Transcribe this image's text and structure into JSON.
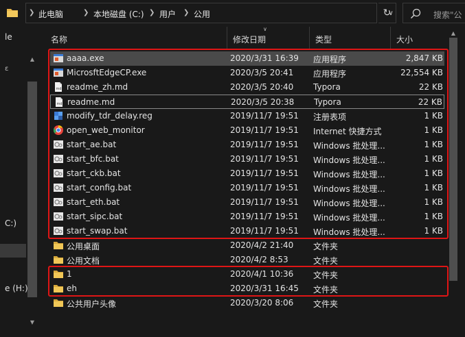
{
  "breadcrumb": {
    "items": [
      "此电脑",
      "本地磁盘 (C:)",
      "用户",
      "公用"
    ]
  },
  "search": {
    "placeholder": "搜索\"公"
  },
  "nav": {
    "items": [
      {
        "label": "le"
      },
      {
        "label": "ε"
      },
      {
        "label": "C:)"
      },
      {
        "label": "e (H:)"
      }
    ]
  },
  "columns": {
    "name": "名称",
    "date": "修改日期",
    "type": "类型",
    "size": "大小"
  },
  "files": [
    {
      "name": "aaaa.exe",
      "date": "2020/3/31 16:39",
      "type": "应用程序",
      "size": "2,847 KB",
      "icon": "exe-icon"
    },
    {
      "name": "MicrosftEdgeCP.exe",
      "date": "2020/3/5 20:41",
      "type": "应用程序",
      "size": "22,554 KB",
      "icon": "exe-icon"
    },
    {
      "name": "readme_zh.md",
      "date": "2020/3/5 20:40",
      "type": "Typora",
      "size": "22 KB",
      "icon": "md-icon"
    },
    {
      "name": "readme.md",
      "date": "2020/3/5 20:38",
      "type": "Typora",
      "size": "22 KB",
      "icon": "md-icon"
    },
    {
      "name": "modify_tdr_delay.reg",
      "date": "2019/11/7 19:51",
      "type": "注册表项",
      "size": "1 KB",
      "icon": "reg-icon"
    },
    {
      "name": "open_web_monitor",
      "date": "2019/11/7 19:51",
      "type": "Internet 快捷方式",
      "size": "1 KB",
      "icon": "url-icon"
    },
    {
      "name": "start_ae.bat",
      "date": "2019/11/7 19:51",
      "type": "Windows 批处理...",
      "size": "1 KB",
      "icon": "bat-icon"
    },
    {
      "name": "start_bfc.bat",
      "date": "2019/11/7 19:51",
      "type": "Windows 批处理...",
      "size": "1 KB",
      "icon": "bat-icon"
    },
    {
      "name": "start_ckb.bat",
      "date": "2019/11/7 19:51",
      "type": "Windows 批处理...",
      "size": "1 KB",
      "icon": "bat-icon"
    },
    {
      "name": "start_config.bat",
      "date": "2019/11/7 19:51",
      "type": "Windows 批处理...",
      "size": "1 KB",
      "icon": "bat-icon"
    },
    {
      "name": "start_eth.bat",
      "date": "2019/11/7 19:51",
      "type": "Windows 批处理...",
      "size": "1 KB",
      "icon": "bat-icon"
    },
    {
      "name": "start_sipc.bat",
      "date": "2019/11/7 19:51",
      "type": "Windows 批处理...",
      "size": "1 KB",
      "icon": "bat-icon"
    },
    {
      "name": "start_swap.bat",
      "date": "2019/11/7 19:51",
      "type": "Windows 批处理...",
      "size": "1 KB",
      "icon": "bat-icon"
    },
    {
      "name": "公用桌面",
      "date": "2020/4/2 21:40",
      "type": "文件夹",
      "size": "",
      "icon": "folder-icon"
    },
    {
      "name": "公用文档",
      "date": "2020/4/2 8:53",
      "type": "文件夹",
      "size": "",
      "icon": "folder-icon"
    },
    {
      "name": "1",
      "date": "2020/4/1 10:36",
      "type": "文件夹",
      "size": "",
      "icon": "folder-icon"
    },
    {
      "name": "eh",
      "date": "2020/3/31 16:45",
      "type": "文件夹",
      "size": "",
      "icon": "folder-icon"
    },
    {
      "name": "公共用户头像",
      "date": "2020/3/20 8:06",
      "type": "文件夹",
      "size": "",
      "icon": "folder-icon"
    }
  ],
  "colors": {
    "background": "#191919",
    "selection": "#4a4a4a",
    "annotation_red": "#e01515",
    "folder": "#e8b84a"
  }
}
